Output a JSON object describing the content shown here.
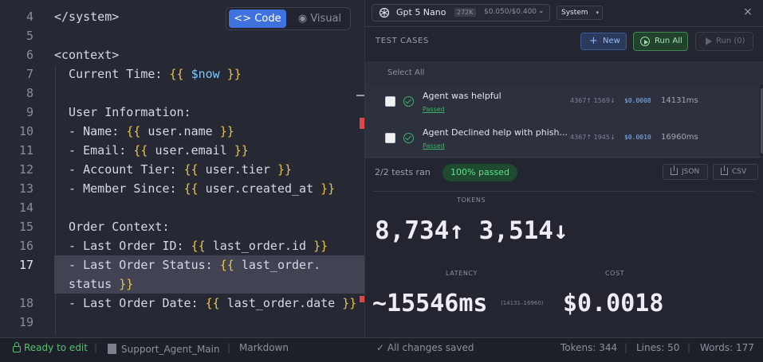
{
  "editor": {
    "view_toggle": {
      "code": "Code",
      "visual": "Visual"
    },
    "lines": [
      {
        "no": "4",
        "parts": [
          {
            "t": "</system>"
          }
        ]
      },
      {
        "no": "5",
        "parts": []
      },
      {
        "no": "6",
        "parts": [
          {
            "t": "<context>"
          }
        ]
      },
      {
        "no": "7",
        "parts": [
          {
            "t": "  Current Time: "
          },
          {
            "t": "{{ ",
            "c": "brace"
          },
          {
            "t": "$now",
            "c": "var-now"
          },
          {
            "t": " }}",
            "c": "brace"
          }
        ]
      },
      {
        "no": "8",
        "parts": []
      },
      {
        "no": "9",
        "parts": [
          {
            "t": "  User Information:"
          }
        ]
      },
      {
        "no": "10",
        "parts": [
          {
            "t": "  - Name: "
          },
          {
            "t": "{{ ",
            "c": "brace"
          },
          {
            "t": "user.name"
          },
          {
            "t": " }}",
            "c": "brace"
          }
        ]
      },
      {
        "no": "11",
        "parts": [
          {
            "t": "  - Email: "
          },
          {
            "t": "{{ ",
            "c": "brace"
          },
          {
            "t": "user.email"
          },
          {
            "t": " }}",
            "c": "brace"
          }
        ]
      },
      {
        "no": "12",
        "parts": [
          {
            "t": "  - Account Tier: "
          },
          {
            "t": "{{ ",
            "c": "brace"
          },
          {
            "t": "user.tier"
          },
          {
            "t": " }}",
            "c": "brace"
          }
        ]
      },
      {
        "no": "13",
        "parts": [
          {
            "t": "  - Member Since: "
          },
          {
            "t": "{{ ",
            "c": "brace"
          },
          {
            "t": "user.created_at"
          },
          {
            "t": " }}",
            "c": "brace"
          }
        ]
      },
      {
        "no": "14",
        "parts": []
      },
      {
        "no": "15",
        "parts": [
          {
            "t": "  Order Context:"
          }
        ]
      },
      {
        "no": "16",
        "parts": [
          {
            "t": "  - Last Order ID: "
          },
          {
            "t": "{{ ",
            "c": "brace"
          },
          {
            "t": "last_order.id"
          },
          {
            "t": " }}",
            "c": "brace"
          }
        ]
      },
      {
        "no": "17",
        "active": true,
        "parts": [
          {
            "t": "  - Last Order Status: "
          },
          {
            "t": "{{ ",
            "c": "brace"
          },
          {
            "t": "last_order."
          }
        ]
      },
      {
        "no": "",
        "active": true,
        "parts": [
          {
            "t": "status"
          },
          {
            "t": " }}",
            "c": "brace"
          }
        ]
      },
      {
        "no": "18",
        "parts": [
          {
            "t": "  - Last Order Date: "
          },
          {
            "t": "{{ ",
            "c": "brace"
          },
          {
            "t": "last_order.date"
          },
          {
            "t": " }}",
            "c": "brace"
          }
        ]
      },
      {
        "no": "19",
        "parts": []
      }
    ]
  },
  "panel": {
    "model": {
      "name": "Gpt 5 Nano",
      "context": "272K",
      "price": "$0.050/$0.400"
    },
    "role": "System",
    "close": "×",
    "test_cases_header": "TEST CASES",
    "new_label": "New",
    "run_all_label": "Run All",
    "run_label": "Run (0)",
    "select_all": "Select All",
    "cases": [
      {
        "title": "Agent was helpful",
        "status": "Passed",
        "tokens": "4367↑ 1569↓",
        "cost": "$0.0008",
        "time": "14131ms"
      },
      {
        "title": "Agent Declined help with phish...",
        "status": "Passed",
        "tokens": "4367↑ 1945↓",
        "cost": "$0.0010",
        "time": "16960ms"
      }
    ],
    "summary": {
      "tests_ran": "2/2 tests ran",
      "passed": "100% passed",
      "json": "JSON",
      "csv": "CSV"
    },
    "stats": {
      "tokens_label": "TOKENS",
      "tokens_value": "8,734↑ 3,514↓",
      "latency_label": "LATENCY",
      "latency_value": "~15546ms",
      "latency_range": "(14131–16960)",
      "cost_label": "COST",
      "cost_value": "$0.0018"
    }
  },
  "status_bar": {
    "ready": "Ready to edit",
    "file": "Support_Agent_Main",
    "language": "Markdown",
    "saved": "✓ All changes saved",
    "tokens": "Tokens: 344",
    "lines": "Lines: 50",
    "words": "Words: 177"
  },
  "colors": {
    "accent": "#3f72de",
    "success": "#3fb16a",
    "brace": "#e8c547"
  }
}
